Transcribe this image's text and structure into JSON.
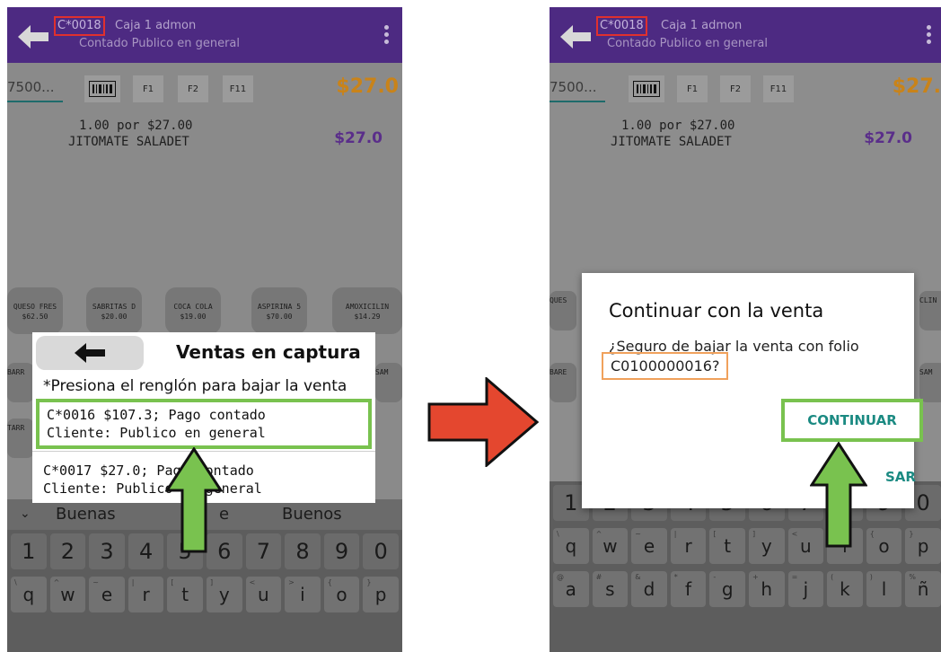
{
  "left": {
    "appbar": {
      "folio": "C*0018",
      "title_rest": "Caja 1 admon",
      "subtitle": "Contado Publico en general"
    },
    "search_value": "7500...",
    "fkeys": [
      "F1",
      "F2",
      "F11"
    ],
    "total": "$27.0",
    "item": {
      "line1": "1.00 por $27.00",
      "line2": "JITOMATE SALADET",
      "price": "$27.0"
    },
    "products": [
      {
        "name": "QUESO FRES",
        "price": "$62.50"
      },
      {
        "name": "SABRITAS D",
        "price": "$20.00"
      },
      {
        "name": "COCA COLA",
        "price": "$19.00"
      },
      {
        "name": "ASPIRINA 5",
        "price": "$70.00"
      },
      {
        "name": "AMOXICILIN",
        "price": "$14.29"
      }
    ],
    "side_stubs": [
      "BARR",
      "TARR",
      "SAM"
    ],
    "dialog": {
      "title": "Ventas en captura",
      "hint": "*Presiona el renglón para bajar la venta",
      "rows": [
        {
          "line1": "C*0016  $107.3; Pago contado",
          "line2": "Cliente: Publico en general"
        },
        {
          "line1": "C*0017  $27.0; Pago contado",
          "line2": "Cliente: Publico en general"
        }
      ]
    },
    "suggestions": [
      "Buenas",
      "e",
      "Buenos"
    ],
    "number_row": [
      "1",
      "2",
      "3",
      "4",
      "5",
      "6",
      "7",
      "8",
      "9",
      "0"
    ],
    "letter_row1": [
      "q",
      "w",
      "e",
      "r",
      "t",
      "y",
      "u",
      "i",
      "o",
      "p"
    ],
    "letter_row1_alts": [
      "\\",
      "^",
      "~",
      "|",
      "[",
      "]",
      "<",
      ">",
      "{",
      "}"
    ]
  },
  "right": {
    "appbar": {
      "folio": "C*0018",
      "title_rest": "Caja 1 admon",
      "subtitle": "Contado Publico en general"
    },
    "search_value": "7500...",
    "fkeys": [
      "F1",
      "F2",
      "F11"
    ],
    "total": "$27.",
    "item": {
      "line1": "1.00 por $27.00",
      "line2": "JITOMATE SALADET",
      "price": "$27.0"
    },
    "side_stubs": [
      "QUES",
      "BARE",
      "CLIN",
      "SAM"
    ],
    "dialog": {
      "title": "Continuar con la venta",
      "message": "¿Seguro de bajar la venta con folio",
      "folio": "C0100000016?",
      "confirm": "CONTINUAR",
      "cancel_peek": "SAR"
    },
    "number_row": [
      "1",
      "2",
      "3",
      "4",
      "5",
      "6",
      "7",
      "8",
      "9",
      "0"
    ],
    "letter_row1": [
      "q",
      "w",
      "e",
      "r",
      "t",
      "y",
      "u",
      "i",
      "o",
      "p"
    ],
    "letter_row1_alts": [
      "\\",
      "^",
      "~",
      "|",
      "[",
      "]",
      "<",
      ">",
      "{",
      "}"
    ],
    "letter_row2": [
      "a",
      "s",
      "d",
      "f",
      "g",
      "h",
      "j",
      "k",
      "l",
      "ñ"
    ],
    "letter_row2_alts": [
      "@",
      "#",
      "&",
      "*",
      "-",
      "+",
      "=",
      "(",
      ")",
      "%"
    ]
  },
  "colors": {
    "appbar": "#4d2a82",
    "highlight_green": "#79c24f",
    "highlight_red": "#e0302e",
    "highlight_orange": "#f0a15c",
    "accent_teal": "#1b8a82",
    "arrow_red": "#e4472f"
  },
  "icons": [
    "back-arrow-icon",
    "barcode-icon",
    "more-vert-icon",
    "flow-arrow-icon",
    "pointer-up-arrow-icon"
  ]
}
